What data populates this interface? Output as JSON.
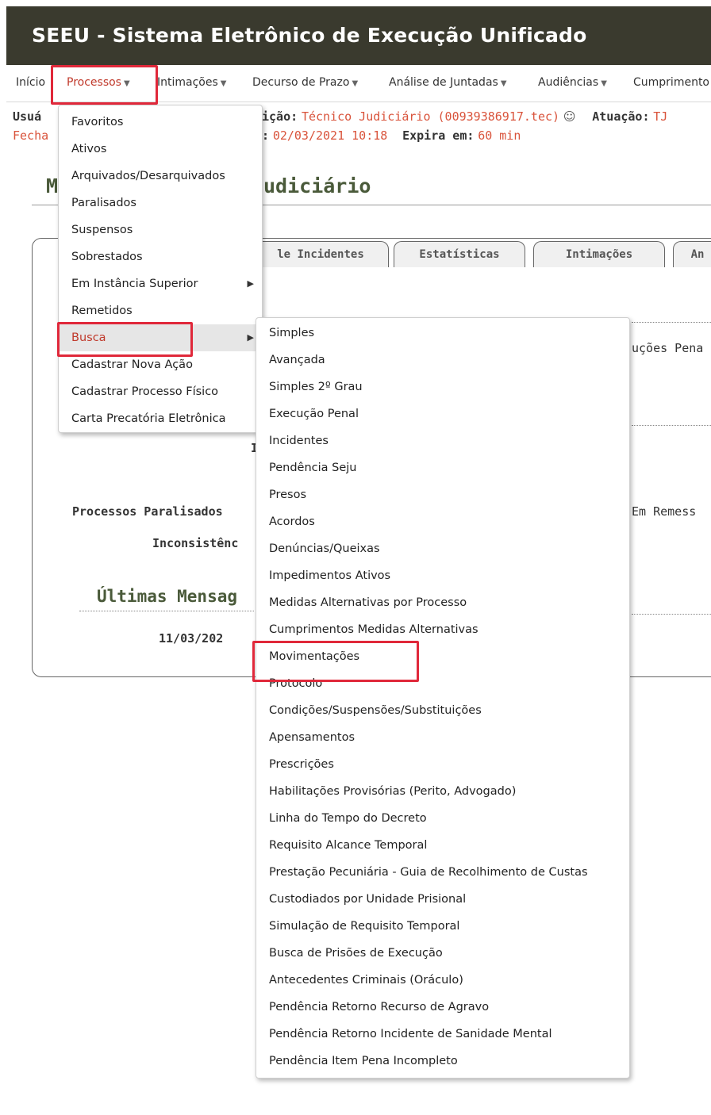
{
  "app": {
    "title": "SEEU - Sistema Eletrônico de Execução Unificado"
  },
  "nav": {
    "items": [
      {
        "label": "Início"
      },
      {
        "label": "Processos"
      },
      {
        "label": "Intimações"
      },
      {
        "label": "Decurso de Prazo"
      },
      {
        "label": "Análise de Juntadas"
      },
      {
        "label": "Audiências"
      },
      {
        "label": "Cumprimento"
      }
    ]
  },
  "user": {
    "user_label": "Usuá",
    "role_label": "ição:",
    "role_value": "Técnico Judiciário (00939386917.tec)",
    "atuacao_label": "Atuação:",
    "atuacao_value": "TJ",
    "close_label": "Fecha",
    "login_prefix": ":",
    "login_time": "02/03/2021 10:18",
    "expires_label": "Expira em:",
    "expires_value": "60 min"
  },
  "panel": {
    "title_left": "M",
    "title_right": "udiciário",
    "tabs": [
      {
        "label": "le Incidentes"
      },
      {
        "label": "Estatísticas"
      },
      {
        "label": "Intimações"
      },
      {
        "label": "An"
      }
    ],
    "lines": {
      "execucoes": "uções Pena",
      "i_letter": "I",
      "paralisados": "Processos Paralisados",
      "remessa": "Em Remess",
      "inconsist": "Inconsistênc",
      "ultimas": "Últimas Mensag",
      "date": "11/03/202"
    }
  },
  "processos_menu": {
    "items": [
      {
        "label": "Favoritos"
      },
      {
        "label": "Ativos"
      },
      {
        "label": "Arquivados/Desarquivados"
      },
      {
        "label": "Paralisados"
      },
      {
        "label": "Suspensos"
      },
      {
        "label": "Sobrestados"
      },
      {
        "label": "Em Instância Superior"
      },
      {
        "label": "Remetidos"
      },
      {
        "label": "Busca"
      },
      {
        "label": "Cadastrar Nova Ação"
      },
      {
        "label": "Cadastrar Processo Físico"
      },
      {
        "label": "Carta Precatória Eletrônica"
      }
    ]
  },
  "busca_menu": {
    "items": [
      {
        "label": "Simples"
      },
      {
        "label": "Avançada"
      },
      {
        "label": "Simples 2º Grau"
      },
      {
        "label": "Execução Penal"
      },
      {
        "label": "Incidentes"
      },
      {
        "label": "Pendência Seju"
      },
      {
        "label": "Presos"
      },
      {
        "label": "Acordos"
      },
      {
        "label": "Denúncias/Queixas"
      },
      {
        "label": "Impedimentos Ativos"
      },
      {
        "label": "Medidas Alternativas por Processo"
      },
      {
        "label": "Cumprimentos Medidas Alternativas"
      },
      {
        "label": "Movimentações"
      },
      {
        "label": "Protocolo"
      },
      {
        "label": "Condições/Suspensões/Substituições"
      },
      {
        "label": "Apensamentos"
      },
      {
        "label": "Prescrições"
      },
      {
        "label": "Habilitações Provisórias (Perito, Advogado)"
      },
      {
        "label": "Linha do Tempo do Decreto"
      },
      {
        "label": "Requisito Alcance Temporal"
      },
      {
        "label": "Prestação Pecuniária - Guia de Recolhimento de Custas"
      },
      {
        "label": "Custodiados por Unidade Prisional"
      },
      {
        "label": "Simulação de Requisito Temporal"
      },
      {
        "label": "Busca de Prisões de Execução"
      },
      {
        "label": "Antecedentes Criminais (Oráculo)"
      },
      {
        "label": "Pendência Retorno Recurso de Agravo"
      },
      {
        "label": "Pendência Retorno Incidente de Sanidade Mental"
      },
      {
        "label": "Pendência Item Pena Incompleto"
      }
    ]
  },
  "colors": {
    "header_bg": "#3a3a2e",
    "accent_red": "#c0392b",
    "highlight_box": "#e0283a",
    "orange_text": "#d9533b"
  }
}
